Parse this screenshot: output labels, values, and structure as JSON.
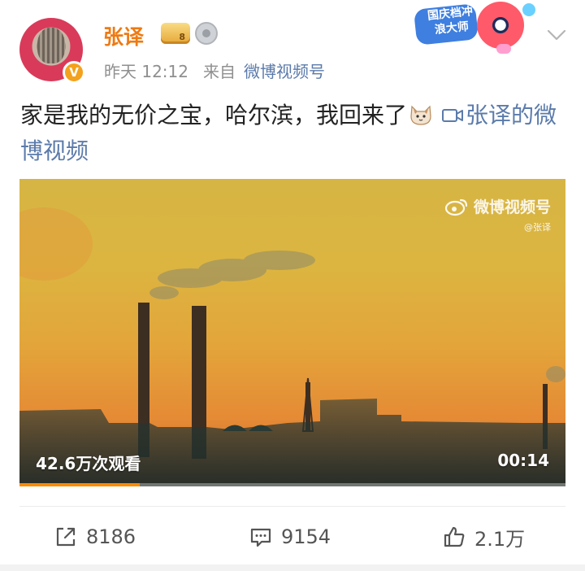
{
  "post": {
    "author": {
      "name": "张译",
      "avatar": "cat-avatar",
      "verified_badge": "V",
      "badges": [
        "gold-member-badge",
        "silver-medal-badge"
      ]
    },
    "meta": {
      "time": "昨天 12:12",
      "from_label": "来自",
      "source": "微博视频号"
    },
    "promo": {
      "text": "国庆档冲浪大师"
    },
    "content": {
      "text": "家是我的无价之宝，哈尔滨，我回来了",
      "emoji": "cat-face-emoji",
      "link_text": "张译的微博视频"
    },
    "video": {
      "watermark": "微博视频号",
      "watermark_sub": "@张译",
      "views": "42.6万次观看",
      "duration": "00:14",
      "progress": 0.22
    },
    "actions": {
      "share_count": "8186",
      "comment_count": "9154",
      "like_count": "2.1万"
    }
  },
  "colors": {
    "name": "#ee7a12",
    "link": "#5b7bab",
    "meta": "#8f8f8f",
    "progress": "#ff8a00"
  }
}
